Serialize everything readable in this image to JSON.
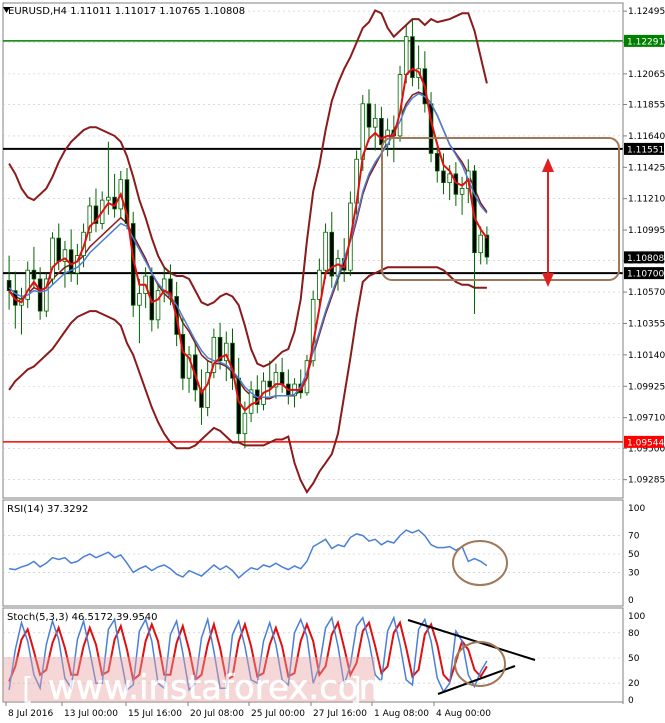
{
  "chart_data": [
    {
      "type": "candlestick",
      "title": "EURUSD,H4  1.11011 1.11017 1.10765 1.10808",
      "ylim": [
        1.0918,
        1.1253
      ],
      "y_ticks": [
        "1.12495",
        "1.12280",
        "1.12065",
        "1.11855",
        "1.11640",
        "1.11425",
        "1.11210",
        "1.10995",
        "1.10785",
        "1.10570",
        "1.10355",
        "1.10140",
        "1.09925",
        "1.09710",
        "1.09500",
        "1.09285"
      ],
      "x_ticks": [
        "8 Jul 2016",
        "13 Jul 00:00",
        "15 Jul 16:00",
        "20 Jul 08:00",
        "25 Jul 00:00",
        "27 Jul 16:00",
        "1 Aug 08:00",
        "4 Aug 00:00"
      ],
      "levels": [
        {
          "value": 1.12291,
          "label": "1.12291",
          "color": "#008000"
        },
        {
          "value": 1.11551,
          "label": "1.11551",
          "color": "#000000"
        },
        {
          "value": 1.107,
          "label": "1.10700",
          "color": "#000000"
        },
        {
          "value": 1.09544,
          "label": "1.09544",
          "color": "#ff0000"
        }
      ],
      "current_price": {
        "value": 1.10808,
        "label": "1.10808"
      },
      "ohlc": [
        [
          1.1065,
          1.1082,
          1.1045,
          1.1058
        ],
        [
          1.1058,
          1.1071,
          1.1032,
          1.1048
        ],
        [
          1.1048,
          1.106,
          1.1028,
          1.1052
        ],
        [
          1.1052,
          1.1078,
          1.1046,
          1.1072
        ],
        [
          1.1072,
          1.1088,
          1.106,
          1.1066
        ],
        [
          1.1066,
          1.1074,
          1.1038,
          1.1044
        ],
        [
          1.1044,
          1.107,
          1.104,
          1.1066
        ],
        [
          1.1066,
          1.1098,
          1.1062,
          1.1094
        ],
        [
          1.1094,
          1.1104,
          1.1072,
          1.1078
        ],
        [
          1.1078,
          1.1092,
          1.106,
          1.1086
        ],
        [
          1.1086,
          1.11,
          1.1064,
          1.107
        ],
        [
          1.107,
          1.109,
          1.1062,
          1.1082
        ],
        [
          1.1082,
          1.1104,
          1.1074,
          1.1098
        ],
        [
          1.1098,
          1.1122,
          1.1092,
          1.1116
        ],
        [
          1.1116,
          1.1128,
          1.1098,
          1.1104
        ],
        [
          1.1104,
          1.1126,
          1.11,
          1.112
        ],
        [
          1.112,
          1.116,
          1.111,
          1.1122
        ],
        [
          1.1122,
          1.1138,
          1.1108,
          1.1114
        ],
        [
          1.1114,
          1.114,
          1.1108,
          1.1134
        ],
        [
          1.1134,
          1.1142,
          1.11,
          1.1104
        ],
        [
          1.1104,
          1.1112,
          1.104,
          1.1048
        ],
        [
          1.1048,
          1.1066,
          1.1022,
          1.1056
        ],
        [
          1.1056,
          1.1074,
          1.1046,
          1.1068
        ],
        [
          1.1068,
          1.1074,
          1.103,
          1.1038
        ],
        [
          1.1038,
          1.1062,
          1.1032,
          1.1058
        ],
        [
          1.1058,
          1.1074,
          1.105,
          1.1066
        ],
        [
          1.1066,
          1.1076,
          1.1048,
          1.1054
        ],
        [
          1.1054,
          1.1064,
          1.102,
          1.1028
        ],
        [
          1.1028,
          1.104,
          1.099,
          1.0998
        ],
        [
          1.0998,
          1.102,
          1.0988,
          1.1014
        ],
        [
          1.1014,
          1.1024,
          1.0982,
          1.099
        ],
        [
          1.099,
          1.1004,
          1.0966,
          1.0978
        ],
        [
          1.0978,
          1.101,
          1.0972,
          1.1002
        ],
        [
          1.1002,
          1.1032,
          1.0998,
          1.1026
        ],
        [
          1.1026,
          1.1036,
          1.1004,
          1.101
        ],
        [
          1.101,
          1.103,
          1.0996,
          1.1022
        ],
        [
          1.1022,
          1.1032,
          1.099,
          1.0998
        ],
        [
          1.0998,
          1.1012,
          1.0954,
          1.096
        ],
        [
          1.096,
          1.0982,
          1.095,
          1.0974
        ],
        [
          1.0974,
          1.0996,
          1.0968,
          1.099
        ],
        [
          1.099,
          1.1,
          1.0974,
          1.098
        ],
        [
          1.098,
          1.1002,
          1.0976,
          1.0996
        ],
        [
          1.0996,
          1.101,
          1.0986,
          1.0992
        ],
        [
          1.0992,
          1.1008,
          1.0984,
          1.1002
        ],
        [
          1.1002,
          1.1012,
          1.0988,
          1.0994
        ],
        [
          1.0994,
          1.1004,
          1.098,
          1.0986
        ],
        [
          1.0986,
          1.0998,
          1.0978,
          1.0994
        ],
        [
          1.0994,
          1.1004,
          1.0984,
          1.0988
        ],
        [
          1.0988,
          1.1014,
          1.0986,
          1.101
        ],
        [
          1.101,
          1.1058,
          1.1006,
          1.1052
        ],
        [
          1.1052,
          1.108,
          1.1044,
          1.1072
        ],
        [
          1.1072,
          1.1104,
          1.1066,
          1.1098
        ],
        [
          1.1098,
          1.1112,
          1.106,
          1.1068
        ],
        [
          1.1068,
          1.1086,
          1.1058,
          1.108
        ],
        [
          1.108,
          1.1094,
          1.1064,
          1.1072
        ],
        [
          1.1072,
          1.1126,
          1.1068,
          1.1118
        ],
        [
          1.1118,
          1.1154,
          1.111,
          1.1148
        ],
        [
          1.1148,
          1.1192,
          1.114,
          1.1186
        ],
        [
          1.1186,
          1.1196,
          1.116,
          1.117
        ],
        [
          1.117,
          1.1186,
          1.1154,
          1.1176
        ],
        [
          1.1176,
          1.1184,
          1.115,
          1.1158
        ],
        [
          1.1158,
          1.1176,
          1.115,
          1.1168
        ],
        [
          1.1168,
          1.1178,
          1.1146,
          1.1164
        ],
        [
          1.1164,
          1.1212,
          1.116,
          1.1206
        ],
        [
          1.1206,
          1.124,
          1.12,
          1.1232
        ],
        [
          1.1232,
          1.1244,
          1.1198,
          1.1204
        ],
        [
          1.1204,
          1.1226,
          1.1196,
          1.121
        ],
        [
          1.121,
          1.1222,
          1.118,
          1.1186
        ],
        [
          1.1186,
          1.1194,
          1.1146,
          1.1152
        ],
        [
          1.1152,
          1.116,
          1.1132,
          1.114
        ],
        [
          1.114,
          1.1152,
          1.1124,
          1.1132
        ],
        [
          1.1132,
          1.1144,
          1.112,
          1.1138
        ],
        [
          1.1138,
          1.1146,
          1.1116,
          1.1124
        ],
        [
          1.1124,
          1.1136,
          1.111,
          1.1128
        ],
        [
          1.1128,
          1.1148,
          1.1118,
          1.114
        ],
        [
          1.114,
          1.1144,
          1.1042,
          1.1084
        ],
        [
          1.1084,
          1.1102,
          1.1076,
          1.1096
        ],
        [
          1.1096,
          1.1102,
          1.1076,
          1.1081
        ]
      ],
      "bollinger_upper": [
        1.1145,
        1.1138,
        1.1128,
        1.1122,
        1.112,
        1.1124,
        1.1128,
        1.1136,
        1.1146,
        1.1154,
        1.116,
        1.1164,
        1.1168,
        1.117,
        1.117,
        1.1168,
        1.1166,
        1.1164,
        1.116,
        1.115,
        1.1136,
        1.112,
        1.1108,
        1.1094,
        1.1082,
        1.1074,
        1.107,
        1.1068,
        1.1068,
        1.1066,
        1.1058,
        1.105,
        1.1048,
        1.105,
        1.1054,
        1.1056,
        1.1054,
        1.1048,
        1.1034,
        1.1018,
        1.1008,
        1.1006,
        1.1008,
        1.1012,
        1.1016,
        1.1018,
        1.103,
        1.1052,
        1.1092,
        1.1126,
        1.1144,
        1.1168,
        1.1188,
        1.12,
        1.121,
        1.1218,
        1.1228,
        1.1238,
        1.1242,
        1.125,
        1.1248,
        1.1238,
        1.1232,
        1.1236,
        1.124,
        1.1244,
        1.1244,
        1.124,
        1.1244,
        1.1242,
        1.1243,
        1.1244,
        1.1246,
        1.1248,
        1.1248,
        1.1236,
        1.1218,
        1.12
      ],
      "bollinger_lower": [
        1.099,
        1.0996,
        1.1,
        1.1004,
        1.1006,
        1.101,
        1.1014,
        1.1018,
        1.1024,
        1.103,
        1.1036,
        1.104,
        1.1042,
        1.1044,
        1.1044,
        1.1042,
        1.104,
        1.1038,
        1.1034,
        1.1022,
        1.1014,
        1.1002,
        1.099,
        1.0978,
        1.0968,
        1.096,
        1.0954,
        1.095,
        1.095,
        1.095,
        1.0952,
        1.0956,
        1.096,
        1.0964,
        1.0962,
        1.0958,
        1.0954,
        1.0954,
        1.0952,
        1.0952,
        1.0952,
        1.0952,
        1.0954,
        1.0956,
        1.0956,
        1.0958,
        1.094,
        1.0928,
        1.092,
        1.0926,
        1.0934,
        1.094,
        1.0946,
        1.096,
        1.0986,
        1.1012,
        1.104,
        1.1064,
        1.1068,
        1.107,
        1.1072,
        1.1074,
        1.1074,
        1.1074,
        1.1074,
        1.1074,
        1.1074,
        1.1074,
        1.1074,
        1.1074,
        1.1072,
        1.1068,
        1.1064,
        1.1062,
        1.1062,
        1.106,
        1.106,
        1.106
      ],
      "bollinger_middle": [
        1.1058,
        1.1054,
        1.1052,
        1.1056,
        1.106,
        1.1058,
        1.106,
        1.1066,
        1.107,
        1.1074,
        1.1076,
        1.1078,
        1.1082,
        1.1088,
        1.1092,
        1.1096,
        1.11,
        1.1104,
        1.1108,
        1.1104,
        1.1096,
        1.1088,
        1.108,
        1.107,
        1.1062,
        1.1056,
        1.1052,
        1.1046,
        1.1036,
        1.103,
        1.1022,
        1.1014,
        1.101,
        1.1008,
        1.1008,
        1.1006,
        1.1002,
        1.0996,
        1.099,
        1.0986,
        1.0984,
        1.0984,
        1.0984,
        1.0986,
        1.0986,
        1.0986,
        1.0986,
        1.099,
        1.1,
        1.1014,
        1.1028,
        1.1042,
        1.1054,
        1.1066,
        1.1078,
        1.109,
        1.1106,
        1.1124,
        1.1136,
        1.1144,
        1.1152,
        1.116,
        1.1168,
        1.1176,
        1.1186,
        1.1192,
        1.1194,
        1.1192,
        1.1186,
        1.1178,
        1.1168,
        1.1158,
        1.1152,
        1.1146,
        1.1138,
        1.1128,
        1.1118,
        1.1112
      ],
      "ma_blue": [
        1.106,
        1.1056,
        1.1054,
        1.1055,
        1.1058,
        1.1057,
        1.1058,
        1.1062,
        1.1066,
        1.107,
        1.1072,
        1.1074,
        1.1078,
        1.1084,
        1.1088,
        1.1092,
        1.1096,
        1.11,
        1.1104,
        1.1102,
        1.1094,
        1.1086,
        1.1078,
        1.107,
        1.1063,
        1.1058,
        1.1054,
        1.1048,
        1.104,
        1.1032,
        1.1024,
        1.1017,
        1.1012,
        1.101,
        1.1009,
        1.1007,
        1.1003,
        1.0998,
        1.0992,
        1.0988,
        1.0985,
        1.0985,
        1.0985,
        1.0986,
        1.0986,
        1.0986,
        1.0987,
        1.0992,
        1.1002,
        1.1016,
        1.103,
        1.1044,
        1.1056,
        1.1068,
        1.108,
        1.1092,
        1.1108,
        1.1126,
        1.1138,
        1.1146,
        1.1152,
        1.1158,
        1.1166,
        1.1174,
        1.1184,
        1.119,
        1.1193,
        1.1191,
        1.1186,
        1.1178,
        1.1168,
        1.1158,
        1.1151,
        1.1144,
        1.1134,
        1.1124,
        1.1116,
        1.1111
      ],
      "ma_red": [
        1.1058,
        1.1052,
        1.105,
        1.1058,
        1.1064,
        1.1058,
        1.106,
        1.1074,
        1.1078,
        1.108,
        1.1076,
        1.1078,
        1.1088,
        1.1102,
        1.1106,
        1.1112,
        1.1118,
        1.1116,
        1.1124,
        1.111,
        1.108,
        1.1062,
        1.1062,
        1.105,
        1.1052,
        1.1058,
        1.1056,
        1.104,
        1.1016,
        1.1012,
        1.1,
        1.0988,
        1.0994,
        1.1008,
        1.1012,
        1.1014,
        1.1004,
        1.0982,
        1.0976,
        1.098,
        1.0982,
        1.0988,
        1.099,
        1.0994,
        1.0994,
        1.099,
        1.099,
        1.099,
        1.0998,
        1.1022,
        1.1046,
        1.107,
        1.1074,
        1.1076,
        1.1074,
        1.1094,
        1.1118,
        1.115,
        1.1162,
        1.1166,
        1.1162,
        1.1164,
        1.1164,
        1.118,
        1.1206,
        1.121,
        1.1208,
        1.1198,
        1.1174,
        1.1158,
        1.1144,
        1.114,
        1.1132,
        1.113,
        1.1134,
        1.1108,
        1.11,
        1.1094
      ]
    },
    {
      "type": "line",
      "title": "RSI(14) 37.3292",
      "ylim": [
        0,
        100
      ],
      "y_ticks": [
        "100",
        "70",
        "50",
        "30",
        "0"
      ],
      "values": [
        34,
        33,
        36,
        38,
        42,
        36,
        40,
        46,
        44,
        46,
        40,
        42,
        47,
        50,
        46,
        49,
        52,
        46,
        49,
        40,
        30,
        34,
        37,
        32,
        36,
        38,
        34,
        28,
        25,
        32,
        29,
        26,
        32,
        38,
        33,
        37,
        32,
        24,
        30,
        35,
        33,
        38,
        36,
        40,
        36,
        33,
        37,
        34,
        42,
        58,
        62,
        66,
        56,
        60,
        58,
        68,
        72,
        70,
        64,
        66,
        60,
        64,
        62,
        70,
        76,
        73,
        76,
        70,
        60,
        57,
        57,
        58,
        54,
        58,
        42,
        45,
        42,
        37.3292
      ]
    },
    {
      "type": "line",
      "title": "Stoch(5,3,3) 46.5172 39.9540",
      "ylim": [
        0,
        100
      ],
      "y_ticks": [
        "100",
        "80",
        "50",
        "20",
        "0"
      ],
      "main": [
        12,
        60,
        92,
        70,
        30,
        14,
        66,
        94,
        72,
        26,
        14,
        72,
        94,
        58,
        20,
        20,
        84,
        96,
        50,
        12,
        18,
        82,
        96,
        70,
        20,
        14,
        78,
        94,
        56,
        12,
        20,
        74,
        96,
        58,
        14,
        14,
        78,
        94,
        64,
        24,
        20,
        70,
        92,
        66,
        24,
        18,
        80,
        96,
        76,
        20,
        40,
        86,
        98,
        64,
        18,
        42,
        88,
        98,
        70,
        30,
        22,
        82,
        98,
        66,
        24,
        18,
        84,
        96,
        70,
        26,
        10,
        20,
        82,
        70,
        30,
        16,
        34,
        46.5172
      ],
      "signal": [
        22,
        40,
        72,
        84,
        58,
        30,
        36,
        68,
        86,
        62,
        30,
        30,
        64,
        86,
        66,
        30,
        34,
        72,
        88,
        60,
        24,
        30,
        70,
        90,
        70,
        30,
        30,
        68,
        88,
        60,
        24,
        30,
        66,
        90,
        62,
        24,
        28,
        70,
        90,
        64,
        28,
        32,
        66,
        86,
        64,
        28,
        32,
        70,
        90,
        70,
        30,
        40,
        78,
        92,
        62,
        30,
        44,
        82,
        92,
        64,
        32,
        40,
        80,
        92,
        62,
        28,
        36,
        78,
        90,
        66,
        30,
        22,
        46,
        70,
        60,
        36,
        28,
        39.954
      ]
    },
    {
      "watermark": "www.instaforex.com"
    }
  ]
}
